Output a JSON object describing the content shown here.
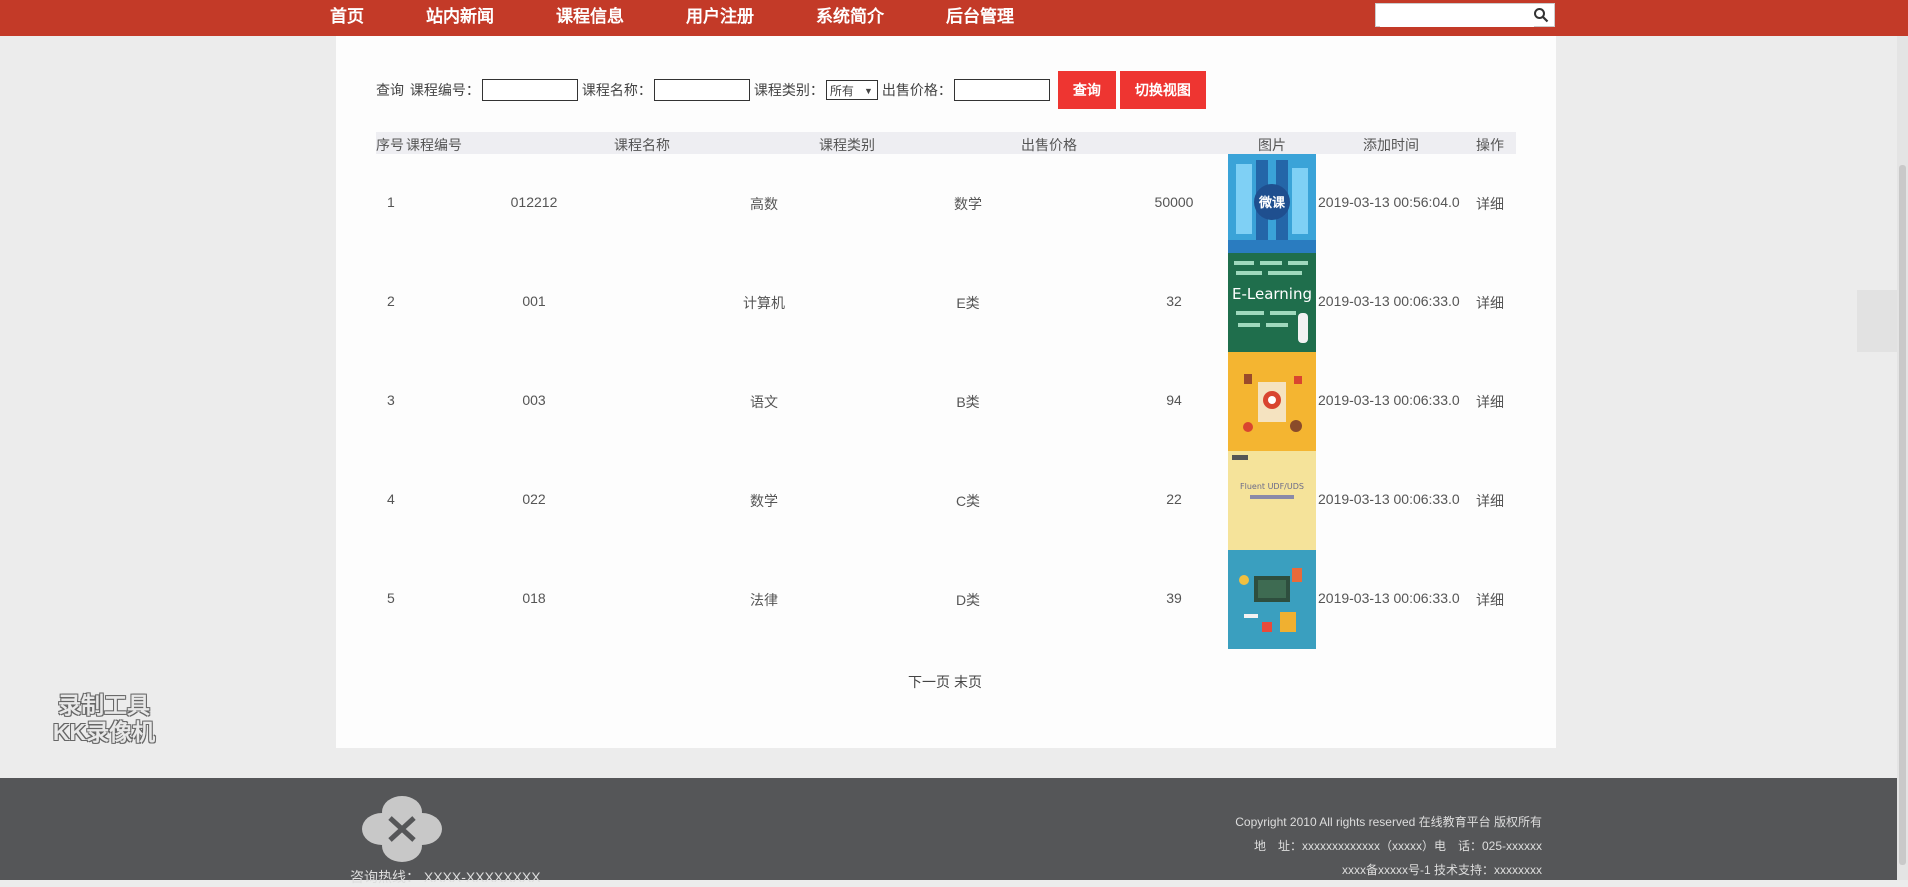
{
  "nav": {
    "items": [
      "首页",
      "站内新闻",
      "课程信息",
      "用户注册",
      "系统简介",
      "后台管理"
    ],
    "search_placeholder": ""
  },
  "filter": {
    "label_query": "查询",
    "label_code": "课程编号：",
    "label_name": "课程名称：",
    "label_type": "课程类别：",
    "type_selected": "所有",
    "label_price": "出售价格：",
    "btn_query": "查询",
    "btn_switch": "切换视图"
  },
  "table": {
    "headers": [
      "序号",
      "课程编号",
      "课程名称",
      "课程类别",
      "出售价格",
      "图片",
      "添加时间",
      "操作"
    ],
    "rows": [
      {
        "seq": "1",
        "code": "012212",
        "name": "高数",
        "type": "数学",
        "price": "50000",
        "image": "微课",
        "time": "2019-03-13 00:56:04.0",
        "op": "详细"
      },
      {
        "seq": "2",
        "code": "001",
        "name": "计算机",
        "type": "E类",
        "price": "32",
        "image": "E-Learning",
        "time": "2019-03-13 00:06:33.0",
        "op": "详细"
      },
      {
        "seq": "3",
        "code": "003",
        "name": "语文",
        "type": "B类",
        "price": "94",
        "image": "",
        "time": "2019-03-13 00:06:33.0",
        "op": "详细"
      },
      {
        "seq": "4",
        "code": "022",
        "name": "数学",
        "type": "C类",
        "price": "22",
        "image": "Fluent UDF/UDS",
        "time": "2019-03-13 00:06:33.0",
        "op": "详细"
      },
      {
        "seq": "5",
        "code": "018",
        "name": "法律",
        "type": "D类",
        "price": "39",
        "image": "",
        "time": "2019-03-13 00:06:33.0",
        "op": "详细"
      }
    ]
  },
  "pager": {
    "next": "下一页",
    "last": "末页"
  },
  "watermark": [
    "录制工具",
    "KK录像机"
  ],
  "footer": {
    "hotline": "咨询热线： XXXX-XXXXXXXX",
    "copyright": "Copyright 2010 All rights reserved 在线教育平台 版权所有",
    "address": "地　址：xxxxxxxxxxxxx（xxxxx）电　话：025-xxxxxx",
    "icp": "xxxx备xxxxx号-1 技术支持：xxxxxxxx"
  },
  "colors": {
    "nav_bg": "#c33a28",
    "button_bg": "#ee3531",
    "footer_bg": "#555658"
  }
}
